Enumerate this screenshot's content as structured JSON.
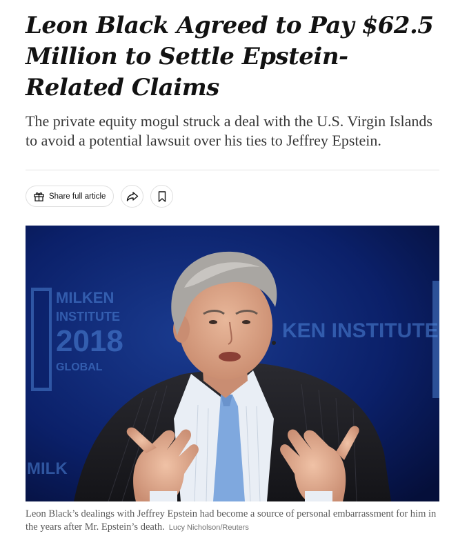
{
  "article": {
    "headline": "Leon Black Agreed to Pay $62.5 Million to Settle Epstein-Related Claims",
    "summary": "The private equity mogul struck a deal with the U.S. Virgin Islands to avoid a potential lawsuit over his ties to Jeffrey Epstein."
  },
  "toolbar": {
    "share_full_article_label": "Share full article",
    "share_icon": "share-arrow-icon",
    "gift_icon": "gift-icon",
    "bookmark_icon": "bookmark-icon"
  },
  "photo": {
    "caption": "Leon Black’s dealings with Jeffrey Epstein had become a source of personal embarrassment for him in the years after Mr. Epstein’s death.",
    "credit": "Lucy Nicholson/Reuters",
    "backdrop_text": [
      "MILKEN",
      "INSTITUTE",
      "2018",
      "GLOBAL",
      "KEN INSTITUTE",
      "MILK"
    ]
  },
  "colors": {
    "text": "#121212",
    "summary": "#363636",
    "caption": "#5a5a5a",
    "photo_backdrop": "#0a1a4f"
  }
}
